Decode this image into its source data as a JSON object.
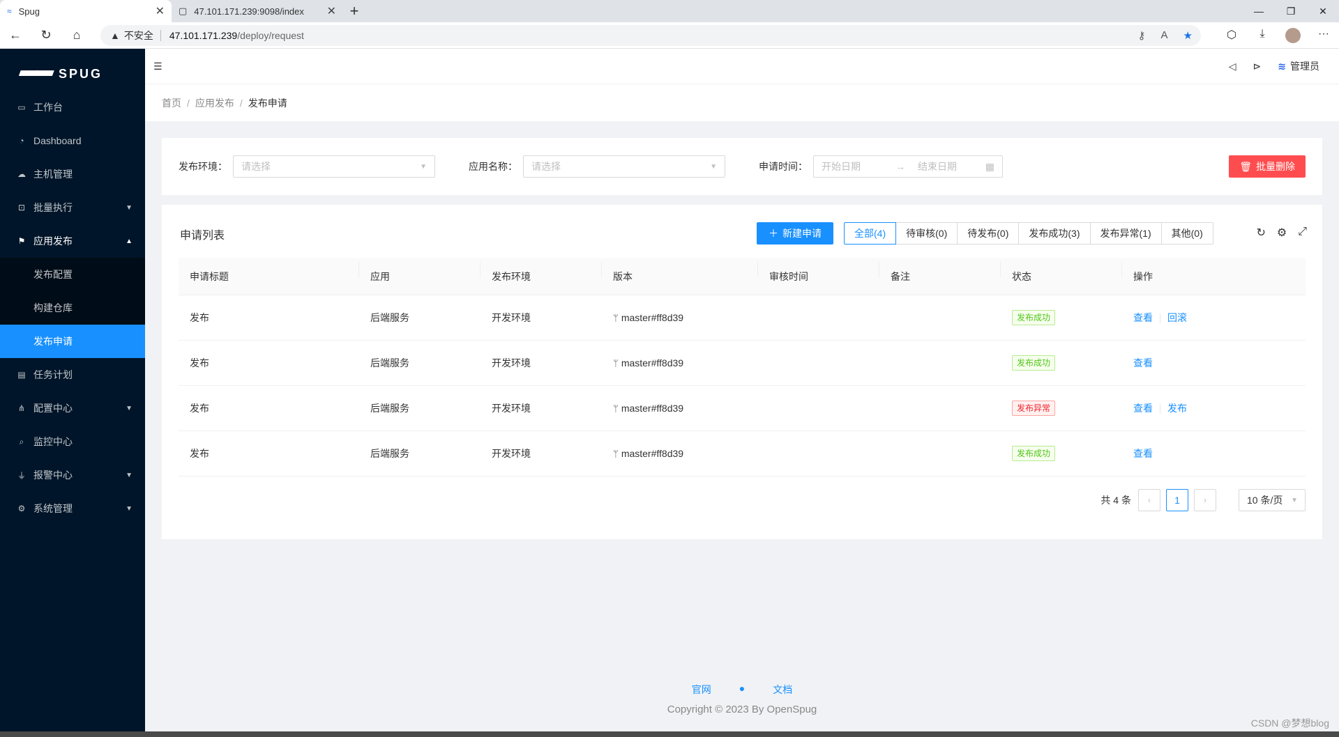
{
  "browser": {
    "tabs": [
      {
        "title": "Spug",
        "active": true
      },
      {
        "title": "47.101.171.239:9098/index",
        "active": false
      }
    ],
    "address": {
      "warning": "不安全",
      "host": "47.101.171.239",
      "path": "/deploy/request"
    }
  },
  "sidebar": {
    "logo_text": "SPUG",
    "items": [
      {
        "label": "工作台",
        "icon": "desktop-icon"
      },
      {
        "label": "Dashboard",
        "icon": "dashboard-icon"
      },
      {
        "label": "主机管理",
        "icon": "cloud-icon"
      },
      {
        "label": "批量执行",
        "icon": "code-icon",
        "expandable": true
      },
      {
        "label": "应用发布",
        "icon": "flag-icon",
        "expandable": true,
        "open": true
      },
      {
        "label": "任务计划",
        "icon": "schedule-icon"
      },
      {
        "label": "配置中心",
        "icon": "apartment-icon",
        "expandable": true
      },
      {
        "label": "监控中心",
        "icon": "monitor-icon"
      },
      {
        "label": "报警中心",
        "icon": "alert-icon",
        "expandable": true
      },
      {
        "label": "系统管理",
        "icon": "setting-icon",
        "expandable": true
      }
    ],
    "submenu": [
      {
        "label": "发布配置",
        "selected": false
      },
      {
        "label": "构建仓库",
        "selected": false
      },
      {
        "label": "发布申请",
        "selected": true
      }
    ]
  },
  "header": {
    "user": "管理员"
  },
  "breadcrumb": [
    "首页",
    "应用发布",
    "发布申请"
  ],
  "filter": {
    "env_label": "发布环境：",
    "env_placeholder": "请选择",
    "app_label": "应用名称：",
    "app_placeholder": "请选择",
    "time_label": "申请时间：",
    "start_placeholder": "开始日期",
    "end_placeholder": "结束日期",
    "batch_delete": "批量删除"
  },
  "list": {
    "title": "申请列表",
    "new_button": "新建申请",
    "tabs": [
      {
        "label": "全部(4)",
        "checked": true
      },
      {
        "label": "待审核(0)",
        "checked": false
      },
      {
        "label": "待发布(0)",
        "checked": false
      },
      {
        "label": "发布成功(3)",
        "checked": false
      },
      {
        "label": "发布异常(1)",
        "checked": false
      },
      {
        "label": "其他(0)",
        "checked": false
      }
    ],
    "columns": [
      "申请标题",
      "应用",
      "发布环境",
      "版本",
      "审核时间",
      "备注",
      "状态",
      "操作"
    ],
    "rows": [
      {
        "title": "发布",
        "app": "后端服务",
        "env": "开发环境",
        "version": "master#ff8d39",
        "review_time": "",
        "note": "",
        "status": "发布成功",
        "status_type": "ok",
        "actions": [
          "查看",
          "回滚"
        ]
      },
      {
        "title": "发布",
        "app": "后端服务",
        "env": "开发环境",
        "version": "master#ff8d39",
        "review_time": "",
        "note": "",
        "status": "发布成功",
        "status_type": "ok",
        "actions": [
          "查看"
        ]
      },
      {
        "title": "发布",
        "app": "后端服务",
        "env": "开发环境",
        "version": "master#ff8d39",
        "review_time": "",
        "note": "",
        "status": "发布异常",
        "status_type": "err",
        "actions": [
          "查看",
          "发布"
        ]
      },
      {
        "title": "发布",
        "app": "后端服务",
        "env": "开发环境",
        "version": "master#ff8d39",
        "review_time": "",
        "note": "",
        "status": "发布成功",
        "status_type": "ok",
        "actions": [
          "查看"
        ]
      }
    ],
    "pagination": {
      "total": "共 4 条",
      "current": "1",
      "page_size": "10 条/页"
    }
  },
  "footer": {
    "links": [
      "官网",
      "文档"
    ],
    "copyright": "Copyright © 2023 By OpenSpug"
  },
  "watermark": "CSDN @梦想blog",
  "colors": {
    "primary": "#1890ff",
    "sidebar": "#001529",
    "danger": "#ff4d4f",
    "success": "#52c41a"
  }
}
